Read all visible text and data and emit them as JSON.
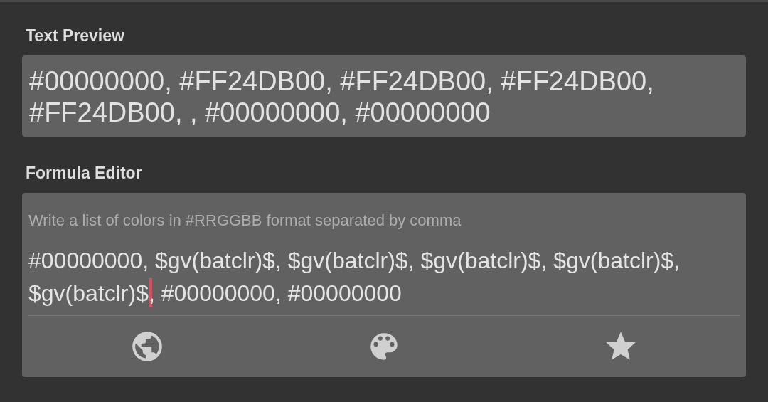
{
  "text_preview": {
    "label": "Text Preview",
    "value": "#00000000, #FF24DB00, #FF24DB00, #FF24DB00, #FF24DB00, , #00000000, #00000000"
  },
  "formula_editor": {
    "label": "Formula Editor",
    "placeholder": "Write a list of colors in #RRGGBB format separated by comma",
    "value_before_cursor": "#00000000, $gv(batclr)$, $gv(batclr)$, $gv(batclr)$, $gv(batclr)$, $gv(batclr)$",
    "value_after_cursor": ", #00000000, #00000000",
    "toolbar": [
      {
        "kind": "globe"
      },
      {
        "kind": "palette"
      },
      {
        "kind": "star"
      }
    ]
  }
}
